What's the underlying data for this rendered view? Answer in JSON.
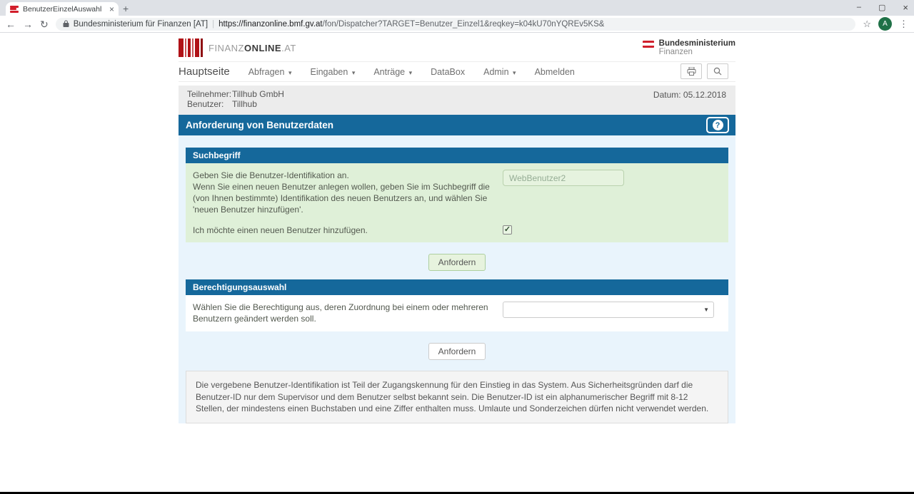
{
  "browser": {
    "tab_title": "BenutzerEinzelAuswahl",
    "minimize": "–",
    "maximize": "▢",
    "close": "×",
    "tab_close": "×",
    "new_tab": "+",
    "back": "←",
    "forward": "→",
    "reload": "↻",
    "security_label": "Bundesministerium  für Finanzen [AT]",
    "url_host": "https://finanzonline.bmf.gv.at",
    "url_path": "/fon/Dispatcher?TARGET=Benutzer_Einzel1&reqkey=k04kU70nYQREv5KS&",
    "star": "☆",
    "avatar_letter": "A",
    "menu_dots": "⋮"
  },
  "header": {
    "logo_finanz": "FINANZ",
    "logo_online": "ONLINE",
    "logo_at": ".AT",
    "ministry_line1": "Bundesministerium",
    "ministry_line2": "Finanzen"
  },
  "nav": {
    "item0": "Hauptseite",
    "item1": "Abfragen",
    "item2": "Eingaben",
    "item3": "Anträge",
    "item4": "DataBox",
    "item5": "Admin",
    "item6": "Abmelden"
  },
  "session": {
    "teilnehmer_label": "Teilnehmer:",
    "teilnehmer_value": "Tillhub GmbH",
    "benutzer_label": "Benutzer:",
    "benutzer_value": "Tillhub",
    "date": "Datum: 05.12.2018"
  },
  "page": {
    "title": "Anforderung von Benutzerdaten",
    "help_glyph": "?"
  },
  "suchbegriff": {
    "header": "Suchbegriff",
    "line1": "Geben Sie die Benutzer-Identifikation an.",
    "line2": "Wenn Sie einen neuen Benutzer anlegen wollen, geben Sie im Suchbegriff die (von Ihnen bestimmte) Identifikation des neuen Benutzers an, und wählen Sie 'neuen Benutzer hinzufügen'.",
    "input_value": "WebBenutzer2",
    "checkbox_label": "Ich möchte einen neuen Benutzer hinzufügen.",
    "checkbox_checked": true,
    "submit_label": "Anfordern"
  },
  "berechtigung": {
    "header": "Berechtigungsauswahl",
    "text": "Wählen Sie die Berechtigung aus, deren Zuordnung bei einem oder mehreren Benutzern geändert werden soll.",
    "select_value": "",
    "select_caret": "▼",
    "submit_label": "Anfordern"
  },
  "footer_info": {
    "text": "Die vergebene Benutzer-Identifikation ist Teil der Zugangskennung für den Einstieg in das System. Aus Sicherheitsgründen darf die Benutzer-ID nur dem Supervisor und dem Benutzer selbst bekannt sein. Die Benutzer-ID ist ein alphanumerischer Begriff mit 8-12 Stellen, der mindestens einen Buchstaben und eine Ziffer enthalten muss. Umlaute und Sonderzeichen dürfen nicht verwendet werden."
  },
  "colors": {
    "primary_blue": "#15689b",
    "light_blue_bg": "#e9f4fc",
    "green_bg": "#dff0d8",
    "gray_band": "#ececec",
    "brand_red": "#b01217"
  }
}
